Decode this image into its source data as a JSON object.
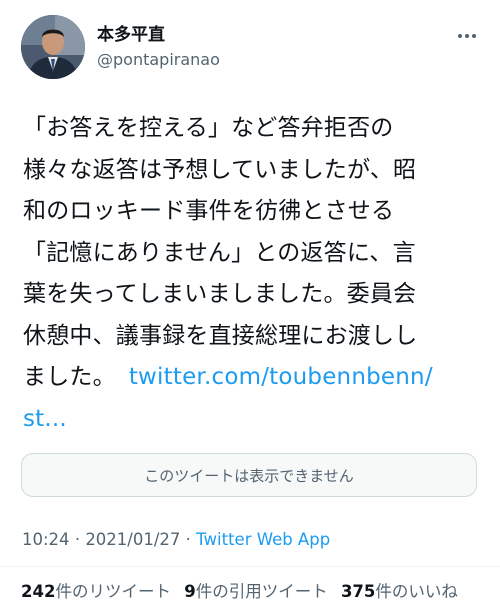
{
  "author": {
    "display_name": "本多平直",
    "handle": "@pontapiranao"
  },
  "tweet": {
    "lines": [
      "「お答えを控える」など答弁拒否の",
      "様々な返答は予想していましたが、昭",
      "和のロッキード事件を彷彿とさせる",
      "「記憶にありません」との返答に、言",
      "葉を失ってしまいましました。委員会",
      "休憩中、議事録を直接総理にお渡しし"
    ],
    "last_line_text": "ました。",
    "link_part1": "twitter.com/toubennbenn/",
    "link_part2": "st..."
  },
  "quoted_tweet": {
    "unavailable_text": "このツイートは表示できません"
  },
  "meta": {
    "time": "10:24",
    "separator": "·",
    "date": "2021/01/27",
    "source": "Twitter Web App"
  },
  "stats": {
    "retweets_count": "242",
    "retweets_label": "件のリツイート",
    "quotes_count": "9",
    "quotes_label": "件の引用ツイート",
    "likes_count": "375",
    "likes_label": "件のいいね"
  },
  "colors": {
    "link": "#1d9bf0",
    "secondary_text": "#536471",
    "primary_text": "#0f1419"
  }
}
